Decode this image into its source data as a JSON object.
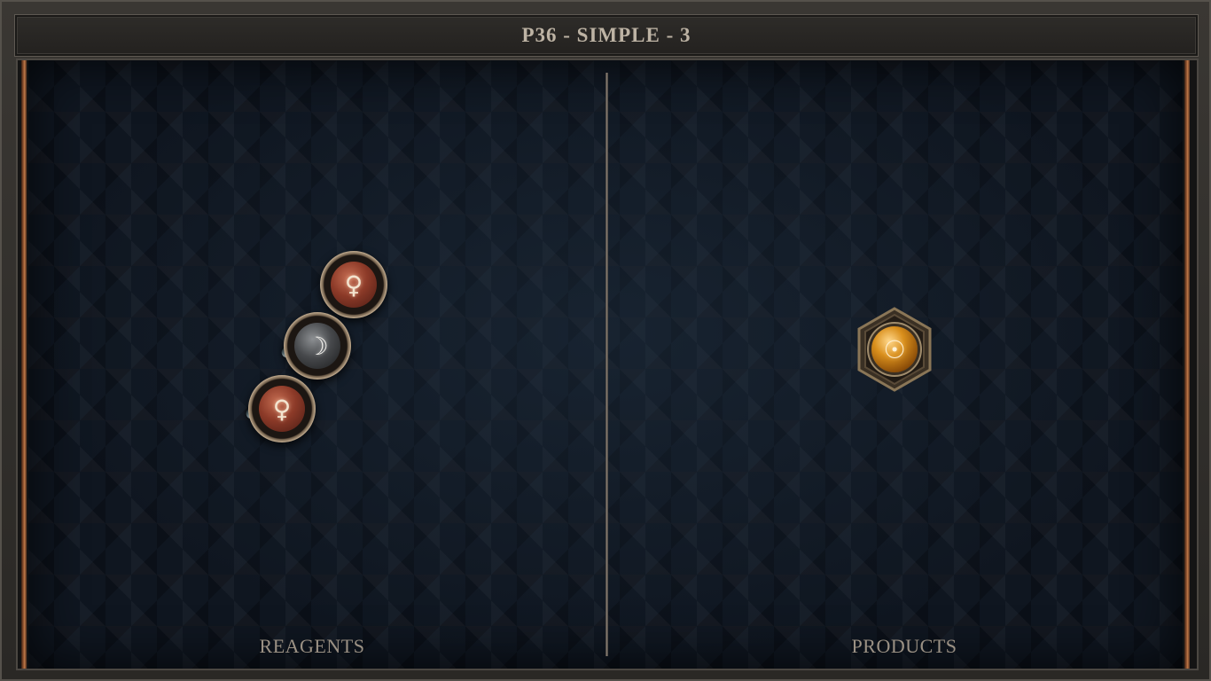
{
  "header": {
    "title": "P36 - SIMPLE - 3"
  },
  "reagents": {
    "label": "REAGENTS",
    "atoms": [
      {
        "element": "copper",
        "symbol": "♀",
        "color": "#8c3a28"
      },
      {
        "element": "silver",
        "symbol": "☽",
        "color": "#47494c"
      },
      {
        "element": "copper",
        "symbol": "♀",
        "color": "#8c3a28"
      }
    ],
    "bond_color": "#c9dbe0"
  },
  "products": {
    "label": "PRODUCTS",
    "atoms": [
      {
        "element": "gold",
        "symbol": "☉",
        "color": "#d98f1c"
      }
    ]
  },
  "theme": {
    "board_color": "#0f1620",
    "rail_color": "#9a5a34",
    "label_color": "#9b9184"
  }
}
